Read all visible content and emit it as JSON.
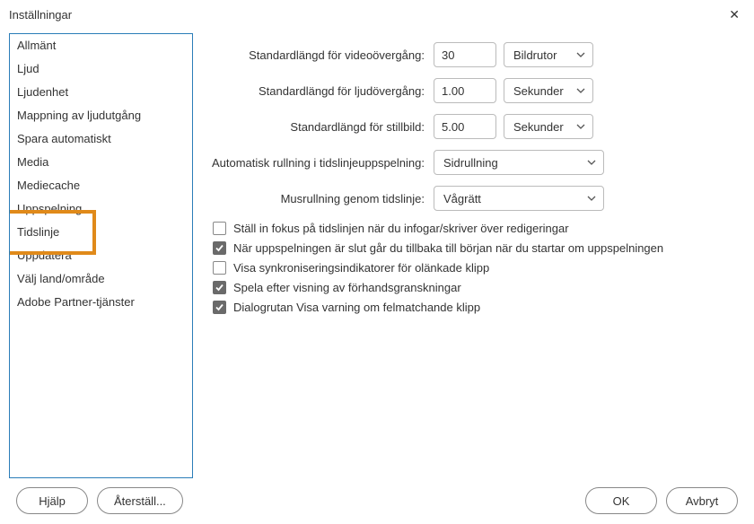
{
  "window": {
    "title": "Inställningar"
  },
  "sidebar": {
    "items": [
      "Allmänt",
      "Ljud",
      "Ljudenhet",
      "Mappning av ljudutgång",
      "Spara automatiskt",
      "Media",
      "Mediecache",
      "Uppspelning",
      "Tidslinje",
      "Uppdatera",
      "Välj land/område",
      "Adobe Partner-tjänster"
    ],
    "highlight_index": 8
  },
  "fields": {
    "video_label": "Standardlängd för videoövergång:",
    "video_value": "30",
    "video_unit": "Bildrutor",
    "audio_label": "Standardlängd för ljudövergång:",
    "audio_value": "1.00",
    "audio_unit": "Sekunder",
    "still_label": "Standardlängd för stillbild:",
    "still_value": "5.00",
    "still_unit": "Sekunder",
    "scroll_label": "Automatisk rullning i tidslinjeuppspelning:",
    "scroll_value": "Sidrullning",
    "mouse_label": "Musrullning genom tidslinje:",
    "mouse_value": "Vågrätt"
  },
  "checks": [
    {
      "checked": false,
      "label": "Ställ in fokus på tidslinjen när du infogar/skriver över redigeringar"
    },
    {
      "checked": true,
      "label": "När uppspelningen är slut går du tillbaka till början när du startar om uppspelningen"
    },
    {
      "checked": false,
      "label": "Visa synkroniseringsindikatorer för olänkade klipp"
    },
    {
      "checked": true,
      "label": "Spela efter visning av förhandsgranskningar"
    },
    {
      "checked": true,
      "label": "Dialogrutan Visa varning om felmatchande klipp"
    }
  ],
  "buttons": {
    "help": "Hjälp",
    "reset": "Återställ...",
    "ok": "OK",
    "cancel": "Avbryt"
  }
}
